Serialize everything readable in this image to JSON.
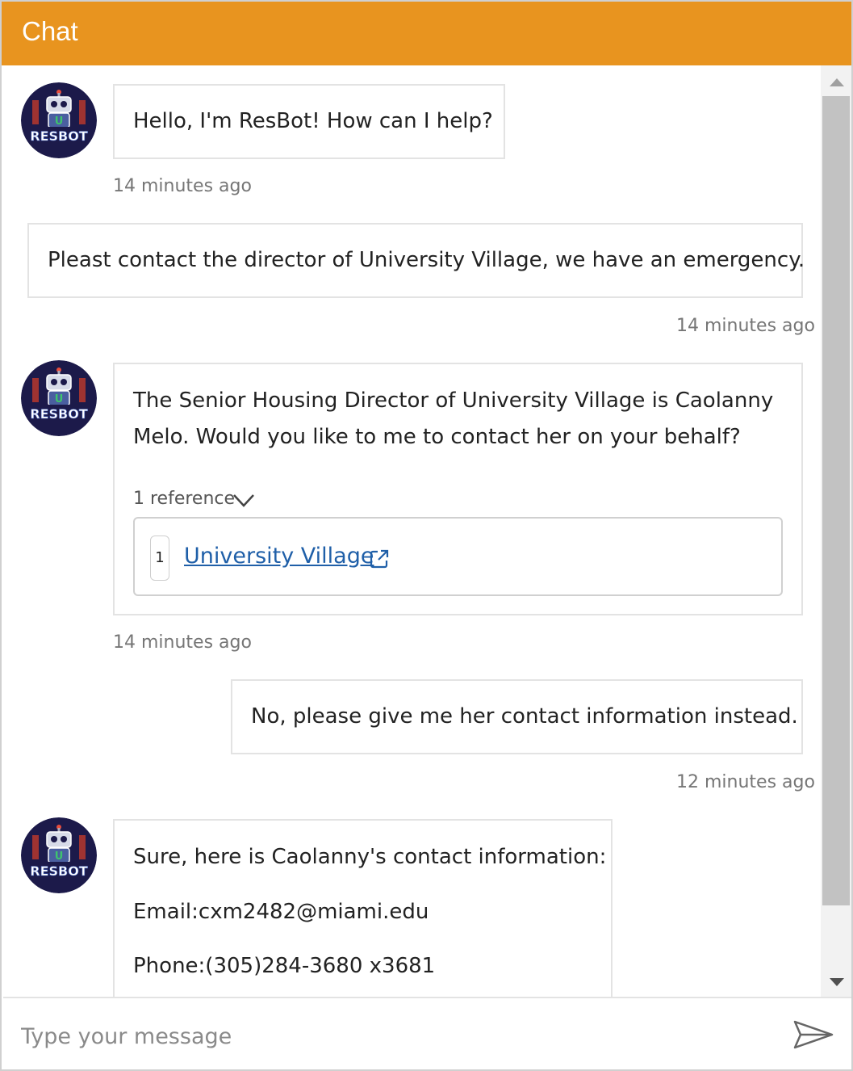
{
  "header": {
    "title": "Chat"
  },
  "bot": {
    "avatar_icon": "resbot-robot-icon",
    "avatar_text": "RESBOT",
    "avatar_letter": "U"
  },
  "messages": [
    {
      "from": "bot",
      "text": "Hello, I'm ResBot! How can I help?",
      "time": "14 minutes ago"
    },
    {
      "from": "user",
      "text": "Pleast contact the director of University Village, we have an emergency.",
      "time": "14 minutes ago"
    },
    {
      "from": "bot",
      "lines": [
        "The Senior Housing Director of University Village is Caolanny",
        "Melo. Would you like to me to contact her on your behalf?"
      ],
      "references_label": "1 reference",
      "reference": {
        "number": "1",
        "title": "University Village"
      },
      "time": "14 minutes ago"
    },
    {
      "from": "user",
      "text": "No, please give me her contact information instead.",
      "time": "12 minutes ago"
    },
    {
      "from": "bot",
      "lines": [
        "Sure, here is Caolanny's contact information:",
        "Email:cxm2482@miami.edu",
        "Phone:(305)284-3680 x3681"
      ]
    }
  ],
  "composer": {
    "placeholder": "Type your message",
    "send_icon": "send-icon"
  },
  "colors": {
    "header": "#e8941f",
    "link": "#1f5fa8",
    "avatar_bg": "#1c1a4a"
  }
}
